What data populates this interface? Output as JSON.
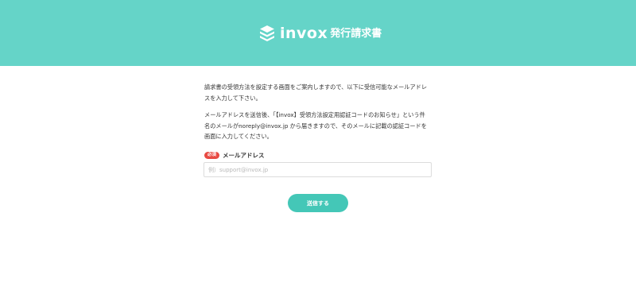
{
  "header": {
    "logo_word": "invox",
    "logo_sub": "発行請求書",
    "logo_icon": "layered-box-icon",
    "background_color": "#65d4c8"
  },
  "intro": {
    "paragraph1": [
      "請求書の受領方法を設定する画面をご案内しますので、以下に受信可能なメールアドレ",
      "スを入力して下さい。"
    ],
    "paragraph2": [
      "メールアドレスを送信後、「【invox】受領方法設定用認証コードのお知らせ」という件",
      "名のメールがnoreply@invox.jp から届きますので、そのメールに記載の認証コードを",
      "画面に入力してください。"
    ]
  },
  "form": {
    "required_badge": "必須",
    "email_label": "メールアドレス",
    "email_value": "",
    "email_placeholder": "例）support@invox.jp",
    "submit_label": "送信する",
    "accent_color": "#44c7b7",
    "required_color": "#e84a43"
  }
}
